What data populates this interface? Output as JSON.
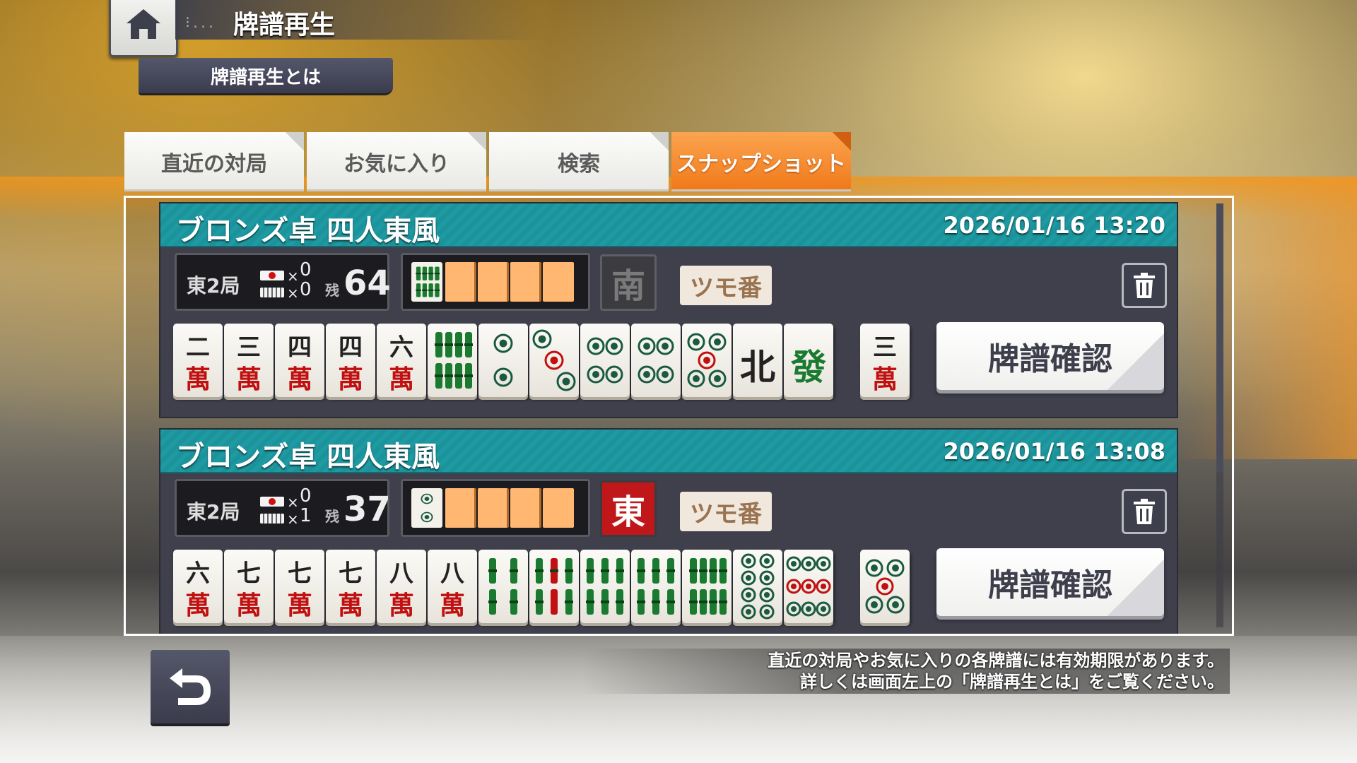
{
  "header": {
    "title": "牌譜再生",
    "dots": "⁝...",
    "about_label": "牌譜再生とは"
  },
  "tabs": [
    {
      "label": "直近の対局",
      "active": false
    },
    {
      "label": "お気に入り",
      "active": false
    },
    {
      "label": "検索",
      "active": false
    },
    {
      "label": "スナップショット",
      "active": true
    }
  ],
  "records": [
    {
      "title": "ブロンズ卓 四人東風",
      "datetime": "2026/01/16 13:20",
      "round": "東2局",
      "riichi_sticks": "0",
      "honba": "0",
      "remaining_label": "残",
      "remaining": "64",
      "dora_indicator": "8-sou",
      "seat_wind": "南",
      "turn_label": "ツモ番",
      "hand": [
        "二萬",
        "三萬",
        "四萬",
        "四萬",
        "六萬",
        "8-sou",
        "2-pin",
        "3-pin",
        "4-pin",
        "4-pin",
        "5-pin",
        "北",
        "發"
      ],
      "draw": "三萬",
      "confirm_label": "牌譜確認"
    },
    {
      "title": "ブロンズ卓 四人東風",
      "datetime": "2026/01/16 13:08",
      "round": "東2局",
      "riichi_sticks": "0",
      "honba": "1",
      "remaining_label": "残",
      "remaining": "37",
      "dora_indicator": "2-pin",
      "seat_wind": "東",
      "turn_label": "ツモ番",
      "hand": [
        "六萬",
        "七萬",
        "七萬",
        "七萬",
        "八萬",
        "八萬",
        "4-sou",
        "5-sou",
        "6-sou",
        "6-sou",
        "8-sou",
        "8-pin",
        "9-pin"
      ],
      "draw": "5-pin",
      "confirm_label": "牌譜確認"
    }
  ],
  "notice": {
    "line1": "直近の対局やお気に入りの各牌譜には有効期限があります。",
    "line2": "詳しくは画面左上の「牌譜再生とは」をご覧ください。"
  },
  "icons": {
    "home": "home-icon",
    "back": "back-arrow-icon",
    "trash": "trash-icon"
  },
  "colors": {
    "accent_tab": "#f07818",
    "card_header": "#1e9aa2",
    "man_red": "#c01010"
  }
}
